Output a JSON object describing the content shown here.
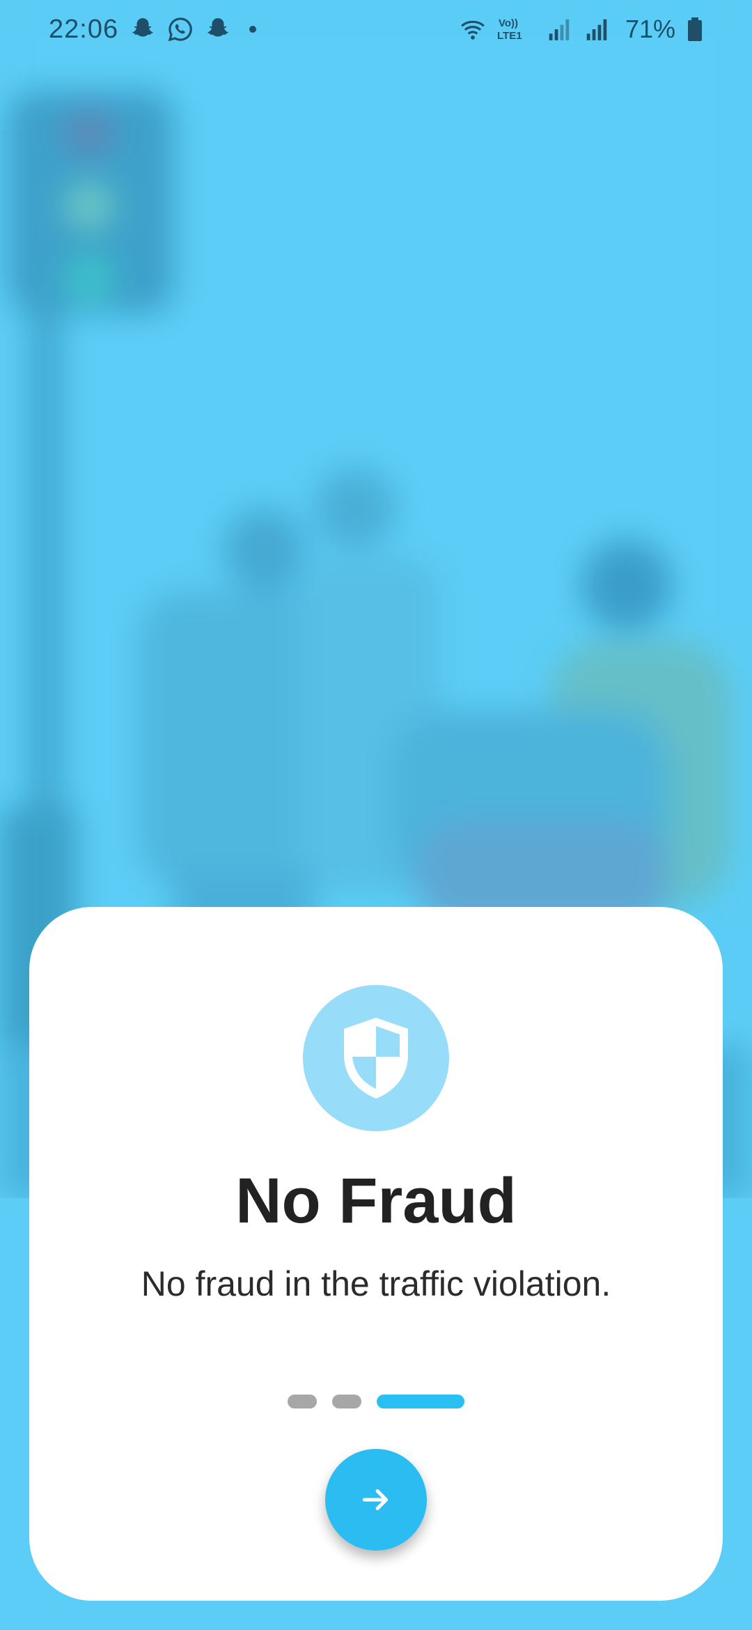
{
  "status_bar": {
    "time": "22:06",
    "notification_icons": [
      "snapchat-icon",
      "whatsapp-icon",
      "snapchat-icon",
      "dot-icon"
    ],
    "network_label": "Vo)) LTE1",
    "battery_percent": "71%"
  },
  "onboarding": {
    "icon": "shield-icon",
    "title": "No Fraud",
    "subtitle": "No fraud in the traffic violation.",
    "pages_total": 3,
    "current_page": 3,
    "next_icon": "arrow-right-icon"
  },
  "colors": {
    "background": "#5bcdf6",
    "accent": "#29bff3",
    "icon_circle": "#97dcf8",
    "inactive_dot": "#a7a7a7"
  }
}
